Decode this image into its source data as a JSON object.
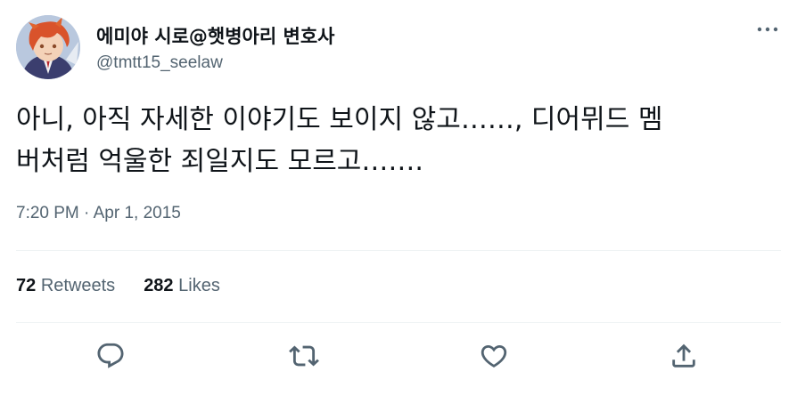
{
  "user": {
    "display_name": "에미야 시로@햇병아리 변호사",
    "handle": "@tmtt15_seelaw"
  },
  "tweet": {
    "text": "아니, 아직 자세한 이야기도 보이지 않고……, 디어뮈드 멤\n버처럼 억울한 죄일지도 모르고…….",
    "timestamp": "7:20 PM · Apr 1, 2015"
  },
  "stats": {
    "retweets_count": "72",
    "retweets_label": "Retweets",
    "likes_count": "282",
    "likes_label": "Likes"
  },
  "icons": {
    "more": "more-icon",
    "reply": "reply-icon",
    "retweet": "retweet-icon",
    "like": "heart-icon",
    "share": "share-icon"
  },
  "colors": {
    "text_primary": "#0f1419",
    "text_secondary": "#536471",
    "divider": "#eff3f4"
  }
}
